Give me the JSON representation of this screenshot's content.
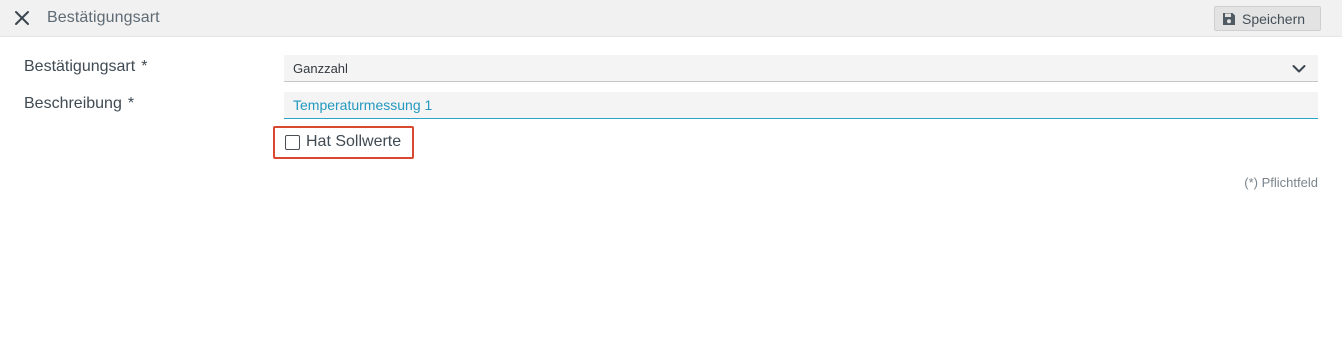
{
  "header": {
    "title": "Bestätigungsart",
    "close_icon": "close-icon",
    "save_label": "Speichern",
    "save_icon": "floppy-disk-icon"
  },
  "form": {
    "type_label": "Bestätigungsart",
    "type_required_mark": "*",
    "type_value": "Ganzzahl",
    "description_label": "Beschreibung",
    "description_required_mark": "*",
    "description_value": "Temperaturmessung 1",
    "has_setpoints_label": "Hat Sollwerte",
    "has_setpoints_checked": false,
    "required_note": "(*) Pflichtfeld"
  },
  "colors": {
    "header_bg": "#f1f1f1",
    "input_accent": "#2aa4c7",
    "highlight_border": "#d8492f"
  }
}
